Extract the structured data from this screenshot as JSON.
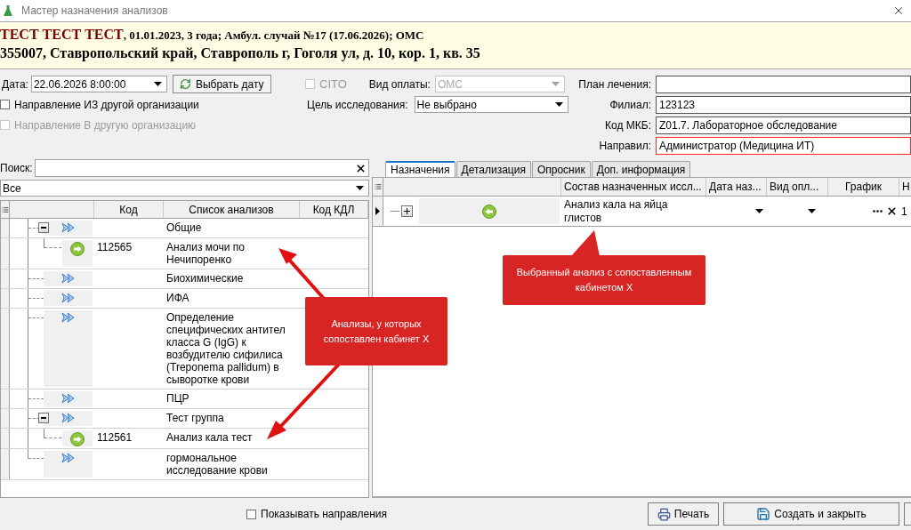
{
  "window": {
    "title": "Мастер назначения анализов"
  },
  "patient": {
    "name": "ТЕСТ ТЕСТ ТЕСТ",
    "details": ", 01.01.2023, 3 года; Амбул. случай №17 (17.06.2026); ОМС",
    "address": "355007, Ставропольский край, Ставрополь г, Гоголя ул, д. 10, кор. 1, кв. 35"
  },
  "form": {
    "date": {
      "label": "Дата:",
      "value": "22.06.2026 8:00:00"
    },
    "pick_date_button": "Выбрать дату",
    "cito": {
      "label": "CITO",
      "checked": false,
      "disabled": true
    },
    "payment": {
      "label": "Вид оплаты:",
      "value": "ОМС",
      "disabled": true
    },
    "from_org": {
      "label": "Направление ИЗ другой организации",
      "checked": false,
      "disabled": false
    },
    "to_org": {
      "label": "Направление В другую организацию",
      "checked": false,
      "disabled": true
    },
    "purpose": {
      "label": "Цель исследования:",
      "value": "Не выбрано"
    },
    "fields": [
      {
        "label": "План лечения:",
        "error": false
      },
      {
        "label": "Филиал:",
        "value": "123123",
        "error": false
      },
      {
        "label": "Код МКБ:",
        "value": "Z01.7. Лабораторное обследование",
        "error": false
      },
      {
        "label": "Направил:",
        "value": "Администратор (Медицина ИТ)",
        "error": true
      }
    ]
  },
  "analyses": {
    "search_label": "Поиск:",
    "filter": "Все",
    "columns": [
      "Код",
      "Список анализов",
      "Код КДЛ"
    ],
    "tree": [
      {
        "kind": "group",
        "name": "Общие",
        "expanded": true,
        "children": [
          {
            "kind": "analysis",
            "code": "112565",
            "name": "Анализ мочи по Нечипоренко"
          }
        ]
      },
      {
        "kind": "group",
        "name": "Биохимические"
      },
      {
        "kind": "group",
        "name": "ИФА"
      },
      {
        "kind": "group",
        "name": "Определение специфических антител класса G (IgG) к возбудителю сифилиса (Treponema pallidum) в сыворотке крови"
      },
      {
        "kind": "group",
        "name": "ПЦР"
      },
      {
        "kind": "group",
        "name": "Тест группа",
        "expanded": true,
        "children": [
          {
            "kind": "analysis",
            "code": "112561",
            "name": "Анализ кала тест"
          }
        ]
      },
      {
        "kind": "group",
        "name": "гормональное исследование крови"
      }
    ]
  },
  "assigned": {
    "tabs": [
      {
        "label": "Назначения",
        "selected": true
      },
      {
        "label": "Детализация",
        "selected": false
      },
      {
        "label": "Опросник",
        "selected": false
      },
      {
        "label": "Доп. информация",
        "selected": false
      }
    ],
    "columns": [
      "Состав назначенных иссл...",
      "Дата наз...",
      "Вид опл...",
      "График",
      "Н"
    ],
    "rows": [
      {
        "name": "Анализ кала на яйца глистов",
        "expanded": false,
        "selected": true,
        "column_5": "1"
      }
    ]
  },
  "footer": {
    "show_directions": {
      "label": "Показывать направления",
      "checked": false
    },
    "buttons": [
      {
        "kind": "print",
        "label": "Печать"
      },
      {
        "kind": "save",
        "label": "Создать и закрыть"
      }
    ]
  },
  "annotations": [
    {
      "text": "Анализы, у которых сопоставлен кабинет Х"
    },
    {
      "text": "Выбранный анализ с сопоставленным кабинетом Х"
    }
  ]
}
